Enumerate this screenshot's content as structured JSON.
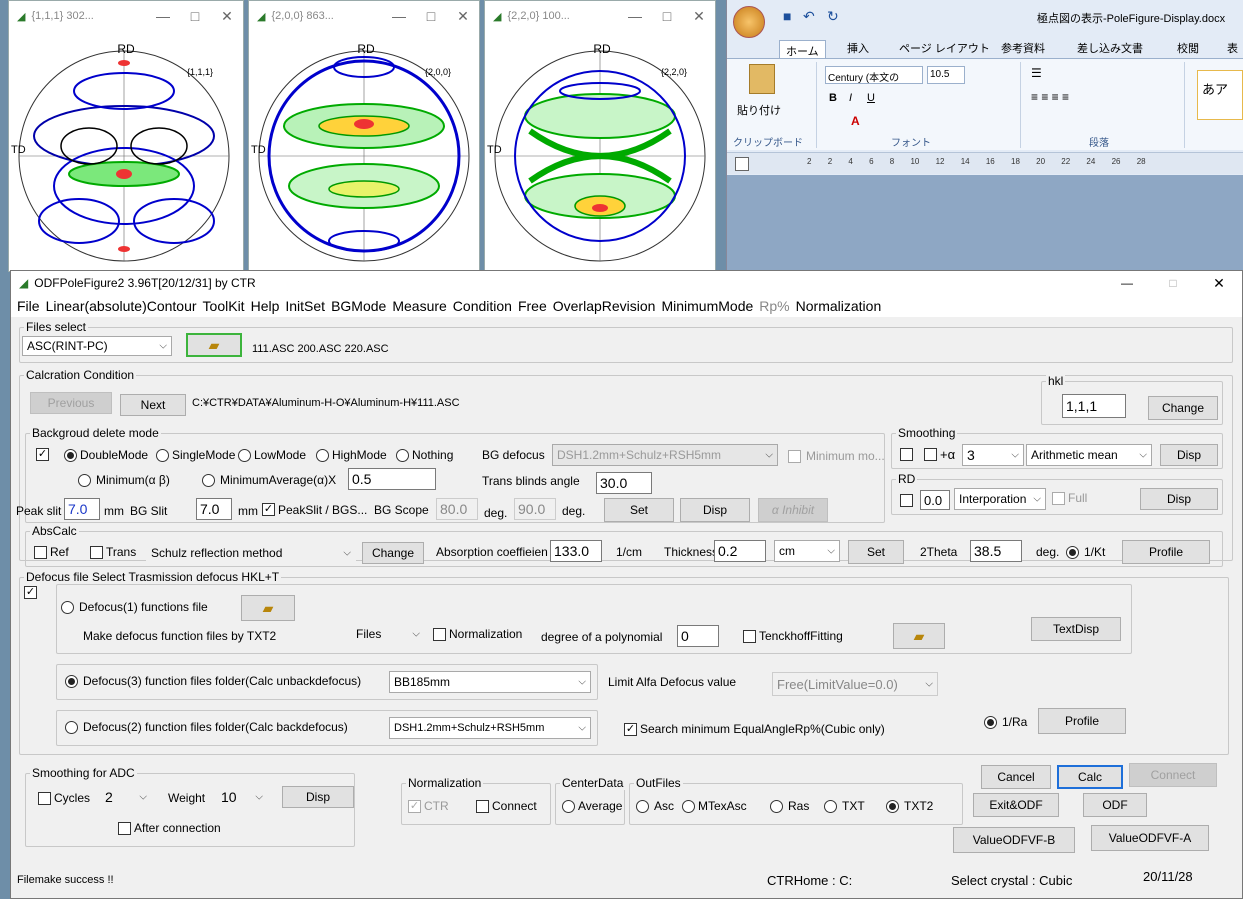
{
  "pole_windows": [
    {
      "title": "{1,1,1} 302...",
      "rd": "RD",
      "td": "TD",
      "hkl": "{1,1,1}"
    },
    {
      "title": "{2,0,0} 863...",
      "rd": "RD",
      "td": "TD",
      "hkl": "{2,0,0}"
    },
    {
      "title": "{2,2,0} 100...",
      "rd": "RD",
      "td": "TD",
      "hkl": "{2,2,0}"
    }
  ],
  "word": {
    "doc_title": "極点図の表示-PoleFigure-Display.docx",
    "tabs": [
      "ホーム",
      "挿入",
      "ページ レイアウト",
      "参考資料",
      "差し込み文書",
      "校閲",
      "表"
    ],
    "paste": "貼り付け",
    "font_name": "Century (本文の",
    "font_size": "10.5",
    "groups": [
      "クリップボード",
      "フォント",
      "段落"
    ],
    "ruler_ticks": [
      "2",
      "2",
      "4",
      "6",
      "8",
      "10",
      "12",
      "14",
      "16",
      "18",
      "20",
      "22",
      "24",
      "26",
      "28"
    ],
    "style_preview": "あア"
  },
  "app": {
    "title": "ODFPoleFigure2 3.96T[20/12/31] by CTR",
    "window_buttons": [
      "—",
      "□",
      "✕"
    ],
    "menu": [
      "File",
      "Linear(absolute)Contour",
      "ToolKit",
      "Help",
      "InitSet",
      "BGMode",
      "Measure",
      "Condition",
      "Free",
      "OverlapRevision",
      "MinimumMode",
      "Rp%",
      "Normalization"
    ],
    "files": {
      "label": "Files select",
      "format": "ASC(RINT-PC)",
      "list": "111.ASC 200.ASC 220.ASC"
    },
    "calc": {
      "label": "Calcration Condition",
      "previous": "Previous",
      "next": "Next",
      "path": "C:¥CTR¥DATA¥Aluminum-H-O¥Aluminum-H¥111.ASC"
    },
    "hkl": {
      "label": "hkl",
      "value": "1,1,1",
      "change": "Change"
    },
    "bg": {
      "label": "Backgroud delete mode",
      "modes": [
        "DoubleMode",
        "SingleMode",
        "LowMode",
        "HighMode",
        "Nothing"
      ],
      "bg_defocus_label": "BG defocus",
      "bg_defocus": "DSH1.2mm+Schulz+RSH5mm",
      "minimum_mode": "Minimum mo...",
      "minimum": "Minimum(α β)",
      "minimum_average": "MinimumAverage(α)X",
      "minavg_value": "0.5",
      "trans_blinds_label": "Trans blinds angle",
      "trans_blinds": "30.0",
      "peak_slit_label": "Peak slit",
      "peak_slit": "7.0",
      "mm": "mm",
      "bg_slit_label": "BG Slit",
      "bg_slit": "7.0",
      "peakslit_bgs": "PeakSlit / BGS...",
      "bg_scope_label": "BG Scope",
      "bg_scope1": "80.0",
      "deg": "deg.",
      "bg_scope2": "90.0",
      "set": "Set",
      "disp": "Disp",
      "inhibit": "α Inhibit"
    },
    "smoothing": {
      "label": "Smoothing",
      "alpha": "+α",
      "value": "3",
      "method": "Arithmetic mean",
      "disp": "Disp"
    },
    "rd": {
      "label": "RD",
      "value": "0.0",
      "method": "Interporation",
      "full": "Full",
      "disp": "Disp"
    },
    "abs": {
      "label": "AbsCalc",
      "ref": "Ref",
      "trans": "Trans",
      "method": "Schulz reflection method",
      "change": "Change",
      "coef_label": "Absorption coeffieien",
      "coef": "133.0",
      "coef_unit": "1/cm",
      "thick_label": "Thickness",
      "thick": "0.2",
      "thick_unit": "cm",
      "set": "Set",
      "twotheta_label": "2Theta",
      "twotheta": "38.5",
      "deg": "deg.",
      "kt": "1/Kt",
      "profile": "Profile"
    },
    "defocus": {
      "label": "Defocus file Select Trasmission defocus HKL+T",
      "d1": "Defocus(1) functions file",
      "make": "Make defocus function files by TXT2",
      "files": "Files",
      "normalization": "Normalization",
      "poly_label": "degree of a polynomial",
      "poly": "0",
      "tenck": "TenckhoffFitting",
      "textdisp": "TextDisp",
      "d3": "Defocus(3) function files folder(Calc unbackdefocus)",
      "d3_value": "BB185mm",
      "limit_label": "Limit Alfa Defocus value",
      "limit": "Free(LimitValue=0.0)",
      "d2": "Defocus(2) function files folder(Calc backdefocus)",
      "d2_value": "DSH1.2mm+Schulz+RSH5mm",
      "search": "Search minimum EqualAngleRp%(Cubic only)",
      "ra": "1/Ra",
      "profile": "Profile"
    },
    "adc": {
      "label": "Smoothing for ADC",
      "cycles": "Cycles",
      "cycles_value": "2",
      "weight": "Weight",
      "weight_value": "10",
      "disp": "Disp",
      "after": "After connection"
    },
    "norm": {
      "label": "Normalization",
      "ctr": "CTR",
      "connect": "Connect"
    },
    "center": {
      "label": "CenterData",
      "average": "Average"
    },
    "out": {
      "label": "OutFiles",
      "items": [
        "Asc",
        "MTexAsc",
        "Ras",
        "TXT",
        "TXT2"
      ]
    },
    "actions": {
      "cancel": "Cancel",
      "calc": "Calc",
      "connect": "Connect",
      "exit_odf": "Exit&ODF",
      "odf": "ODF",
      "vb": "ValueODFVF-B",
      "va": "ValueODFVF-A"
    },
    "status": {
      "message": "Filemake success !!",
      "home": "CTRHome : C:",
      "crystal": "Select crystal : Cubic",
      "date": "20/11/28"
    }
  }
}
